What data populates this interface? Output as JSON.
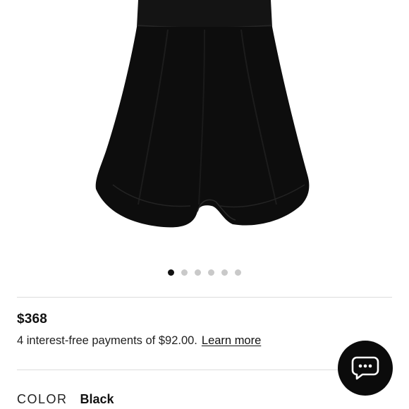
{
  "product": {
    "image_alt": "black dress",
    "price": "$368",
    "installment_text": "4 interest-free payments of $92.00.",
    "learn_more_label": "Learn more",
    "color_label": "COLOR",
    "color_value": "Black",
    "image_count": 6,
    "active_image": 1
  },
  "chat": {
    "icon": "chat-bubble-icon"
  },
  "colors": {
    "garment": "#0d0d0d",
    "active_dot": "#111111",
    "inactive_dot": "#c9c9c9",
    "chat_button": "#0b0b0b"
  }
}
